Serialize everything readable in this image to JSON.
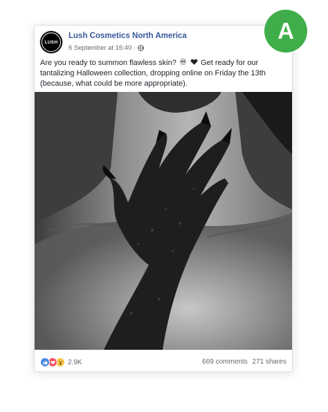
{
  "post": {
    "page_name": "Lush Cosmetics North America",
    "avatar_label": "LUSH",
    "date": "6 September at 16:40 ·",
    "caption_part1": "Are you ready to summon flawless skin?",
    "caption_part2": "Get ready for our tantalizing Halloween collection, dropping online on Friday the 13th (because, what could be more appropriate).",
    "caption_icons": [
      "skull-icon",
      "black-heart-icon"
    ]
  },
  "footer": {
    "reaction_icons": [
      "like-icon",
      "love-icon",
      "wow-icon"
    ],
    "reaction_count": "2.9K",
    "comments": "669 comments",
    "shares": "271 shares"
  },
  "badge": {
    "letter": "A",
    "color": "#3fae4a"
  },
  "colors": {
    "link": "#365899",
    "text": "#1d2129",
    "meta": "#616770",
    "like": "#4a89e8",
    "love": "#f25268",
    "wow": "#f7c84a"
  }
}
